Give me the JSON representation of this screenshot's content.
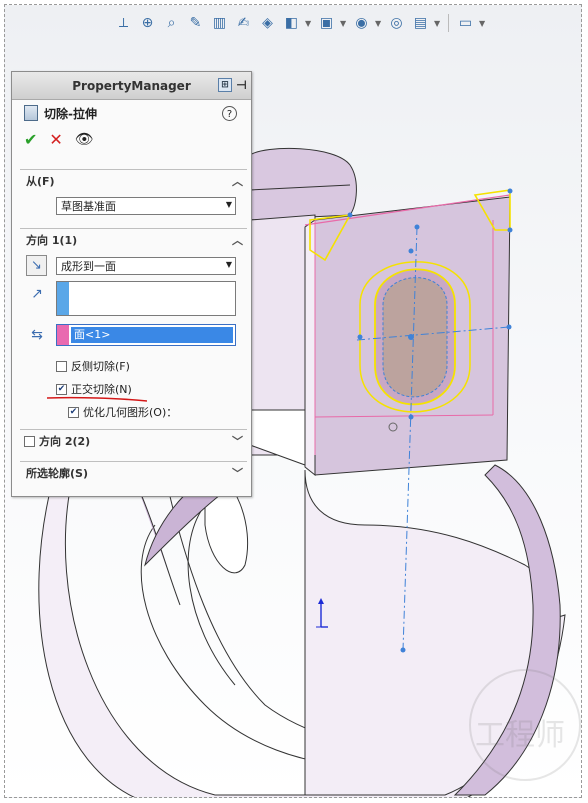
{
  "hud": {
    "icons": [
      "view-orientation-icon",
      "zoom-to-fit-icon",
      "zoom-area-icon",
      "previous-view-icon",
      "section-view-icon",
      "dynamic-annotation-icon",
      "view-orientation-cube-icon",
      "display-style-icon",
      "hide-show-items-icon",
      "edit-appearance-icon",
      "apply-scene-icon",
      "view-settings-icon"
    ]
  },
  "pm": {
    "title": "PropertyManager",
    "feature_name": "切除-拉伸",
    "help_symbol": "?",
    "ok_symbol": "✔",
    "cancel_symbol": "✕",
    "from": {
      "label": "从(F)",
      "value": "草图基准面"
    },
    "direction1": {
      "label": "方向 1(1)",
      "end_condition": "成形到一面",
      "depth_value": "",
      "face_selection": "面<1>",
      "flip_side_label": "反侧切除(F)",
      "flip_side_checked": false,
      "normal_cut_label": "正交切除(N)",
      "normal_cut_checked": true,
      "optimize_label": "优化几何图形(O)：",
      "optimize_checked": true
    },
    "direction2": {
      "label": "方向 2(2)",
      "checked": false
    },
    "selected_contours": {
      "label": "所选轮廓(S)"
    }
  },
  "colors": {
    "model_face": "#d6c5dd",
    "sketch_line": "#f5e200",
    "axis_line": "#3f82d8",
    "selection_pink": "#e86aa8",
    "accent_blue": "#3c6db0"
  }
}
